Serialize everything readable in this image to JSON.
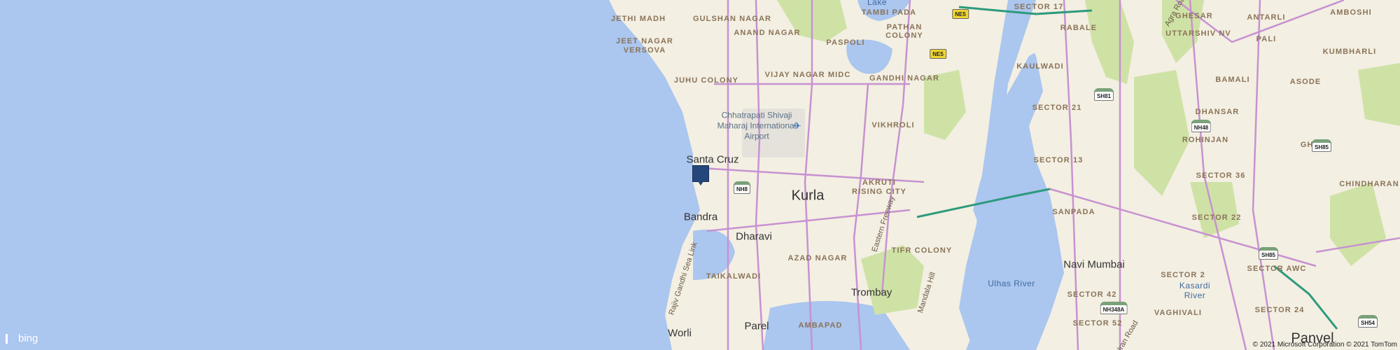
{
  "map": {
    "provider": "bing",
    "copyright": "© 2021 Microsoft Corporation © 2021 TomTom",
    "colors": {
      "water": "#abc6ef",
      "land": "#f3efe2",
      "park": "#cfe2a6",
      "road": "#c792d1",
      "highway": "#2d9a7c"
    }
  },
  "labels": {
    "lake": "Lake",
    "tambi_pada": "TAMBI PADA",
    "jethi_madh": "JETHI MADH",
    "gulshan_nagar": "GULSHAN NAGAR",
    "anand_nagar": "ANAND NAGAR",
    "paspoli": "PASPOLI",
    "pathan_colony": "PATHAN COLONY",
    "sector_17": "SECTOR 17",
    "ghesar": "GHESAR",
    "antarli": "ANTARLI",
    "amboshi": "AMBOSHI",
    "rabale": "RABALE",
    "uttarshiv_nv": "UTTARSHIV NV",
    "pali": "PALI",
    "kumbharli": "KUMBHARLI",
    "jeet_nagar": "JEET NAGAR",
    "versova": "VERSOVA",
    "vijay_nagar_midc": "VIJAY NAGAR MIDC",
    "kaulwadi": "KAULWADI",
    "bamali": "BAMALI",
    "asode": "ASODE",
    "juhu_colony": "JUHU COLONY",
    "gandhi_nagar": "GANDHI NAGAR",
    "sector_21": "SECTOR 21",
    "dhansar": "DHANSAR",
    "airport": "Chhatrapati Shivaji Maharaj International Airport",
    "vikhroli": "VIKHROLI",
    "rohinjan": "ROHINJAN",
    "ghot": "GHOT",
    "santa_cruz": "Santa Cruz",
    "sector_13": "SECTOR 13",
    "sector_36": "SECTOR 36",
    "chindharan": "CHINDHARAN",
    "kurla": "Kurla",
    "akruti_rising_city": "AKRUTI RISING CITY",
    "sanpada": "SANPADA",
    "sector_22": "SECTOR 22",
    "bandra": "Bandra",
    "eastern_freeway": "Eastern Freeway",
    "dharavi": "Dharavi",
    "tifr_colony": "TIFR COLONY",
    "rajiv_gandhi_sea_link": "Rajiv Gandhi Sea Link",
    "navi_mumbai": "Navi Mumbai",
    "sector_awc": "SECTOR AWC",
    "azad_nagar": "AZAD NAGAR",
    "taikalwadi": "TAIKALWADI",
    "ulhas_river": "Ulhas River",
    "sector_2": "SECTOR 2",
    "kasardi_river": "Kasardi River",
    "trombay": "Trombay",
    "mandala_hill": "Mandala Hill",
    "sector_42": "SECTOR 42",
    "vaghivali": "VAGHIVALI",
    "sector_24": "SECTOR 24",
    "parel": "Parel",
    "ambapad": "AMBAPAD",
    "sector_52": "SECTOR 52",
    "panvel": "Panvel",
    "worli": "Worli",
    "agra_road": "Agra Road",
    "uran_road": "Uran Road"
  },
  "shields": {
    "nh8": "NH8",
    "ne5_top": "NE5",
    "ne5_mid": "NE5",
    "sh81": "SH81",
    "nh48": "NH48",
    "sh85_top": "SH85",
    "sh85_bottom": "SH85",
    "nh348a": "NH348A",
    "sh54": "SH54"
  },
  "bing_label": "bing"
}
